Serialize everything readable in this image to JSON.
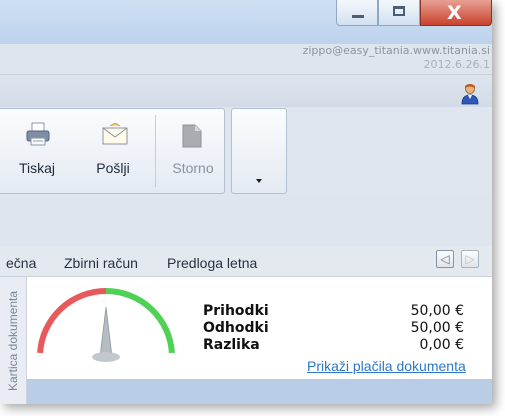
{
  "window": {
    "minimize_icon": "minimize-icon",
    "maximize_icon": "maximize-icon",
    "close_icon": "close-icon",
    "close_glyph": "X"
  },
  "status": {
    "user": "zippo@easy_titania.www.titania.si",
    "version": "2012.6.26.1"
  },
  "ribbon": {
    "buttons": [
      {
        "label": "Tiskaj",
        "icon": "printer-icon",
        "enabled": true
      },
      {
        "label": "Pošlji",
        "icon": "envelope-icon",
        "enabled": true
      },
      {
        "label": "Storno",
        "icon": "document-icon",
        "enabled": false
      }
    ],
    "more_icon": "dropdown-arrow-icon"
  },
  "tabs": [
    {
      "label": "ečna"
    },
    {
      "label": "Zbirni račun"
    },
    {
      "label": "Predloga letna"
    }
  ],
  "tab_nav": {
    "prev_glyph": "◁",
    "next_glyph": "▷"
  },
  "side_panel": {
    "label": "Kartica dokumenta"
  },
  "summary": {
    "rows": [
      {
        "label": "Prihodki",
        "value": "50,00 €"
      },
      {
        "label": "Odhodki",
        "value": "50,00 €"
      },
      {
        "label": "Razlika",
        "value": "0,00 €"
      }
    ],
    "link": "Prikaži plačila dokumenta",
    "gauge_level": 0.5
  },
  "colors": {
    "gauge_red": "#e85a5a",
    "gauge_green": "#4fd155",
    "link": "#2b78c6"
  }
}
